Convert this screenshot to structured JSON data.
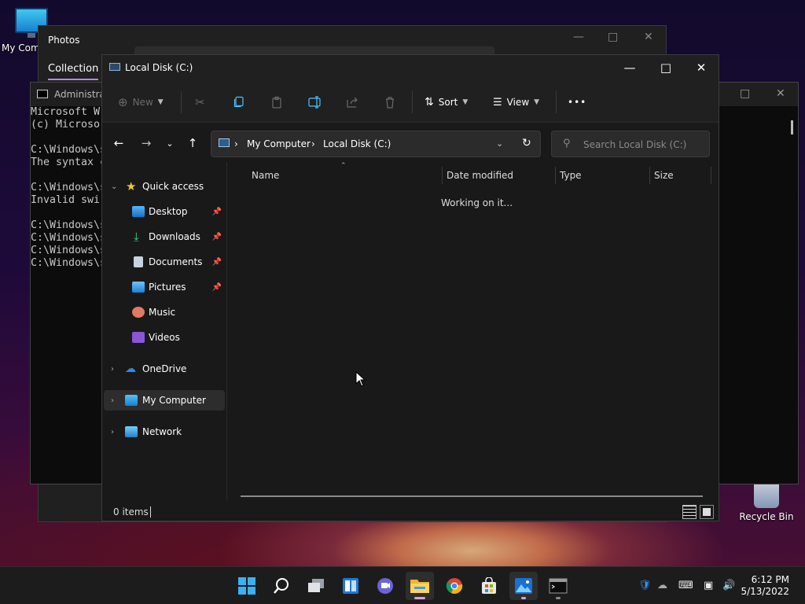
{
  "desktop": {
    "my_computer_label": "My Com",
    "recycle_bin_label": "Recycle Bin"
  },
  "photos": {
    "title": "Photos",
    "tab": "Collection"
  },
  "cmd": {
    "title": "Administra",
    "lines": "Microsoft W\n(c) Microso\n\nC:\\Windows\\s\nThe syntax c\n\nC:\\Windows\\s\nInvalid swi\n\nC:\\Windows\\s\nC:\\Windows\\s\nC:\\Windows\\s\nC:\\Windows\\s"
  },
  "explorer": {
    "title": "Local Disk (C:)",
    "toolbar": {
      "new_label": "New",
      "sort_label": "Sort",
      "view_label": "View",
      "more_label": "•••"
    },
    "address": {
      "crumb1": "My Computer",
      "crumb2": "Local Disk (C:)",
      "sep": "›"
    },
    "search_placeholder": "Search Local Disk (C:)",
    "nav": {
      "quick_access": "Quick access",
      "desktop": "Desktop",
      "downloads": "Downloads",
      "documents": "Documents",
      "pictures": "Pictures",
      "music": "Music",
      "videos": "Videos",
      "onedrive": "OneDrive",
      "my_computer": "My Computer",
      "network": "Network"
    },
    "columns": {
      "name": "Name",
      "date_modified": "Date modified",
      "type": "Type",
      "size": "Size"
    },
    "status_message": "Working on it...",
    "item_count": "0 items"
  },
  "taskbar": {
    "time": "6:12 PM",
    "date": "5/13/2022"
  },
  "colors": {
    "explorer_bg": "#191919",
    "accent": "#4cc2ff",
    "photos_tab_underline": "#b58ad9"
  }
}
